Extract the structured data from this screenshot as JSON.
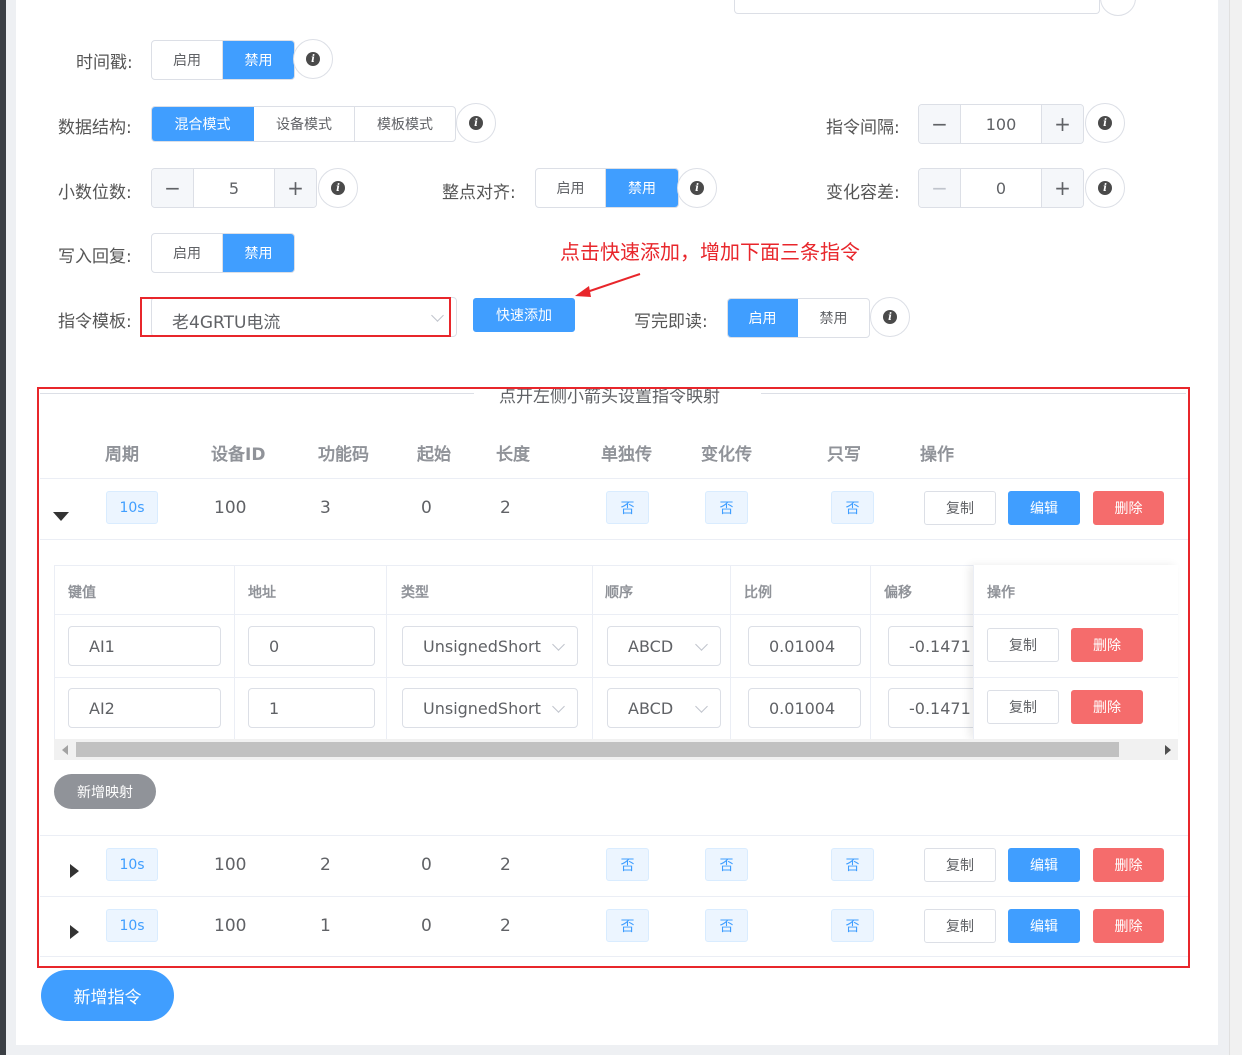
{
  "colors": {
    "primary": "#409eff",
    "danger": "#f56c6c",
    "annotation": "#e8262b"
  },
  "form": {
    "timestamp": {
      "label": "时间戳:",
      "options": [
        "启用",
        "禁用"
      ],
      "selected": "禁用"
    },
    "data_structure": {
      "label": "数据结构:",
      "options": [
        "混合模式",
        "设备模式",
        "模板模式"
      ],
      "selected": "混合模式"
    },
    "cmd_interval": {
      "label": "指令间隔:",
      "value": "100",
      "minus": "−",
      "plus": "+"
    },
    "decimals": {
      "label": "小数位数:",
      "value": "5",
      "minus": "−",
      "plus": "+"
    },
    "hour_align": {
      "label": "整点对齐:",
      "options": [
        "启用",
        "禁用"
      ],
      "selected": "禁用"
    },
    "change_tol": {
      "label": "变化容差:",
      "value": "0",
      "minus": "−",
      "plus": "+"
    },
    "write_reply": {
      "label": "写入回复:",
      "options": [
        "启用",
        "禁用"
      ],
      "selected": "禁用"
    },
    "cmd_template": {
      "label": "指令模板:",
      "value": "老4GRTU电流"
    },
    "quick_add": "快速添加",
    "read_after_write": {
      "label": "写完即读:",
      "options": [
        "启用",
        "禁用"
      ],
      "selected": "启用"
    }
  },
  "annotation_text": "点击快速添加，增加下面三条指令",
  "commands": {
    "legend": "点开左侧小箭头设置指令映射",
    "headers": [
      "周期",
      "设备ID",
      "功能码",
      "起始",
      "长度",
      "单独传",
      "变化传",
      "只写",
      "操作"
    ],
    "rows": [
      {
        "cycle": "10s",
        "device_id": "100",
        "func": "3",
        "start": "0",
        "length": "2",
        "single": "否",
        "change": "否",
        "write_only": "否",
        "expanded": true
      },
      {
        "cycle": "10s",
        "device_id": "100",
        "func": "2",
        "start": "0",
        "length": "2",
        "single": "否",
        "change": "否",
        "write_only": "否",
        "expanded": false
      },
      {
        "cycle": "10s",
        "device_id": "100",
        "func": "1",
        "start": "0",
        "length": "2",
        "single": "否",
        "change": "否",
        "write_only": "否",
        "expanded": false
      }
    ],
    "actions": {
      "copy": "复制",
      "edit": "编辑",
      "delete": "删除"
    },
    "mapping": {
      "headers": [
        "键值",
        "地址",
        "类型",
        "顺序",
        "比例",
        "偏移",
        "操作"
      ],
      "rows": [
        {
          "key": "AI1",
          "addr": "0",
          "type": "UnsignedShort",
          "order": "ABCD",
          "ratio": "0.01004",
          "offset": "-0.1471"
        },
        {
          "key": "AI2",
          "addr": "1",
          "type": "UnsignedShort",
          "order": "ABCD",
          "ratio": "0.01004",
          "offset": "-0.1471"
        }
      ],
      "add_mapping": "新增映射"
    },
    "add_command": "新增指令"
  }
}
